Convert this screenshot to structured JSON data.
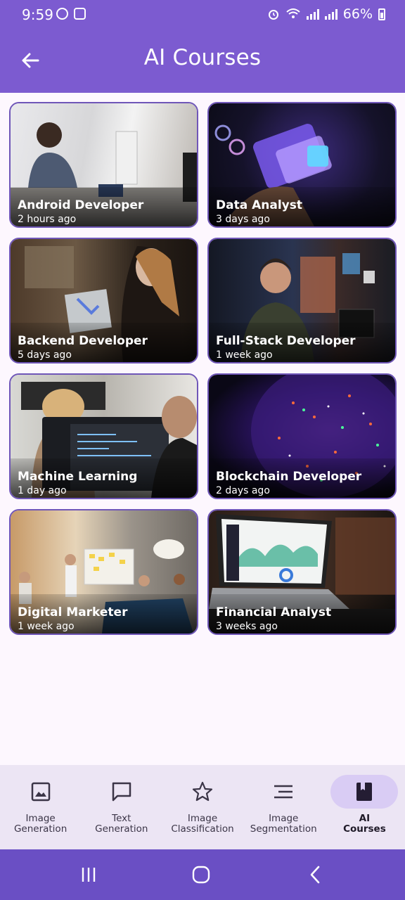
{
  "status_bar": {
    "time": "9:59",
    "battery": "66%"
  },
  "app_bar": {
    "title": "AI Courses"
  },
  "courses": [
    {
      "title": "Android Developer",
      "time": "2 hours ago"
    },
    {
      "title": "Data Analyst",
      "time": "3 days ago"
    },
    {
      "title": "Backend Developer",
      "time": "5 days ago"
    },
    {
      "title": "Full-Stack Developer",
      "time": "1 week ago"
    },
    {
      "title": "Machine Learning",
      "time": "1 day ago"
    },
    {
      "title": "Blockchain Developer",
      "time": "2 days ago"
    },
    {
      "title": "Digital Marketer",
      "time": "1 week ago"
    },
    {
      "title": "Financial Analyst",
      "time": "3 weeks ago"
    }
  ],
  "bottom_nav": {
    "items": [
      {
        "label": "Image\nGeneration",
        "icon": "image-icon",
        "active": false
      },
      {
        "label": "Text\nGeneration",
        "icon": "chat-icon",
        "active": false
      },
      {
        "label": "Image\nClassification",
        "icon": "star-icon",
        "active": false
      },
      {
        "label": "Image\nSegmentation",
        "icon": "lines-icon",
        "active": false
      },
      {
        "label": "AI\nCourses",
        "icon": "book-icon",
        "active": true
      }
    ]
  },
  "colors": {
    "primary": "#7c5bd0",
    "nav_background": "#ece5f4",
    "active_pill": "#d9ccf4",
    "system_nav": "#6a4fc4"
  }
}
